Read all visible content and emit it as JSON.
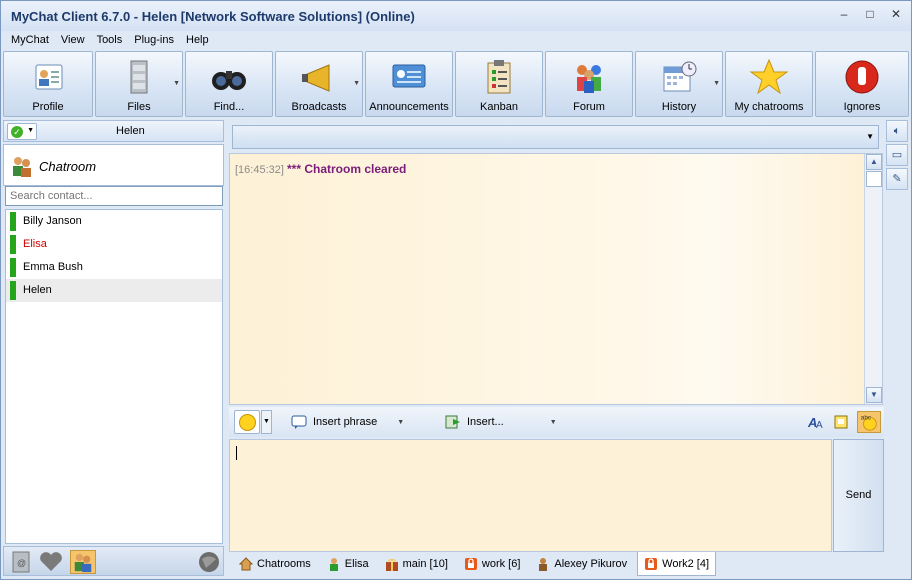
{
  "window": {
    "title": "MyChat Client 6.7.0 - Helen [Network Software Solutions] (Online)",
    "min": "–",
    "max": "□",
    "close": "✕"
  },
  "menu": [
    "MyChat",
    "View",
    "Tools",
    "Plug-ins",
    "Help"
  ],
  "toolbar": [
    {
      "label": "Profile",
      "icon": "profile-icon"
    },
    {
      "label": "Files",
      "icon": "files-icon",
      "dropdown": true
    },
    {
      "label": "Find...",
      "icon": "binoculars-icon"
    },
    {
      "label": "Broadcasts",
      "icon": "megaphone-icon",
      "dropdown": true
    },
    {
      "label": "Announcements",
      "icon": "announcements-icon"
    },
    {
      "label": "Kanban",
      "icon": "clipboard-icon"
    },
    {
      "label": "Forum",
      "icon": "people-icon"
    },
    {
      "label": "History",
      "icon": "calendar-icon",
      "dropdown": true
    },
    {
      "label": "My chatrooms",
      "icon": "star-icon"
    },
    {
      "label": "Ignores",
      "icon": "stop-icon"
    }
  ],
  "user": {
    "name": "Helen"
  },
  "chatroom_header": "Chatroom",
  "search": {
    "placeholder": "Search contact..."
  },
  "contacts": [
    {
      "name": "Billy Janson",
      "status_color": "#25a51a",
      "selected": false,
      "highlight": false
    },
    {
      "name": "Elisa",
      "status_color": "#25a51a",
      "selected": false,
      "highlight": true
    },
    {
      "name": "Emma Bush",
      "status_color": "#25a51a",
      "selected": false,
      "highlight": false
    },
    {
      "name": "Helen",
      "status_color": "#25a51a",
      "selected": true,
      "highlight": false
    }
  ],
  "messages": [
    {
      "time": "[16:45:32]",
      "text": "*** Chatroom cleared"
    }
  ],
  "input_toolbar": {
    "insert_phrase": "Insert phrase",
    "insert": "Insert..."
  },
  "send": "Send",
  "tabs": [
    {
      "label": "Chatrooms",
      "icon": "home-icon",
      "active": false
    },
    {
      "label": "Elisa",
      "icon": "user-icon",
      "active": false
    },
    {
      "label": "main [10]",
      "icon": "gift-icon",
      "active": false
    },
    {
      "label": "work [6]",
      "icon": "lock-icon",
      "active": false
    },
    {
      "label": "Alexey Pikurov",
      "icon": "user-brown-icon",
      "active": false
    },
    {
      "label": "Work2 [4]",
      "icon": "lock-icon",
      "active": true
    }
  ]
}
